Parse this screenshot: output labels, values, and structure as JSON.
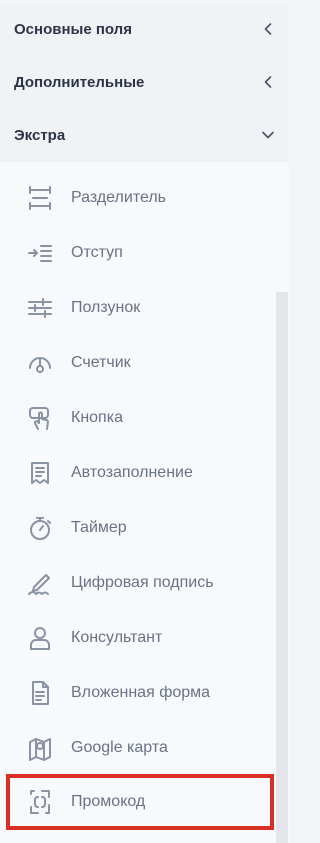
{
  "sections": [
    {
      "title": "Основные поля",
      "state": "collapsed",
      "chevron_icon": "chevron-left-icon"
    },
    {
      "title": "Дополнительные",
      "state": "collapsed",
      "chevron_icon": "chevron-left-icon"
    },
    {
      "title": "Экстра",
      "state": "expanded",
      "chevron_icon": "chevron-down-icon"
    }
  ],
  "extra_items": [
    {
      "label": "Разделитель",
      "icon": "divider-icon"
    },
    {
      "label": "Отступ",
      "icon": "indent-icon"
    },
    {
      "label": "Ползунок",
      "icon": "slider-icon"
    },
    {
      "label": "Счетчик",
      "icon": "gauge-icon"
    },
    {
      "label": "Кнопка",
      "icon": "button-tap-icon"
    },
    {
      "label": "Автозаполнение",
      "icon": "autofill-icon"
    },
    {
      "label": "Таймер",
      "icon": "timer-icon"
    },
    {
      "label": "Цифровая подпись",
      "icon": "signature-icon"
    },
    {
      "label": "Консультант",
      "icon": "user-icon"
    },
    {
      "label": "Вложенная форма",
      "icon": "document-icon"
    },
    {
      "label": "Google карта",
      "icon": "map-icon"
    },
    {
      "label": "Промокод",
      "icon": "promo-code-icon",
      "highlighted": true
    }
  ],
  "colors": {
    "title": "#2c3445",
    "label": "#6a7285",
    "icon": "#8a92a3",
    "highlight_border": "#d93025"
  }
}
